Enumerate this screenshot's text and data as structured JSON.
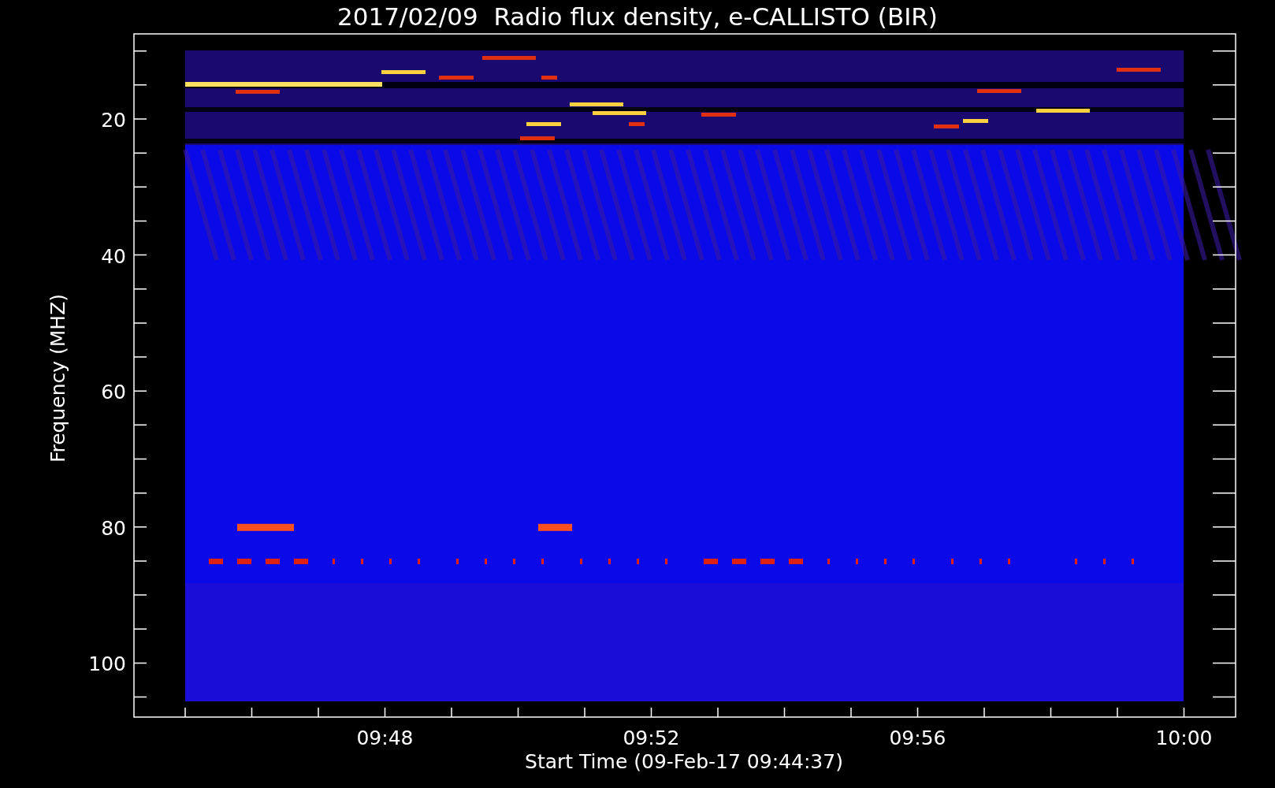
{
  "title": "2017/02/09  Radio flux density, e-CALLISTO (BIR)",
  "plot": {
    "ylabel": "Frequency (MHZ)",
    "xlabel": "Start Time (09-Feb-17 09:44:37)",
    "y_tick_labels": [
      "20",
      "40",
      "60",
      "80",
      "100"
    ],
    "x_tick_labels": [
      "09:48",
      "09:52",
      "09:56",
      "10:00"
    ]
  }
}
